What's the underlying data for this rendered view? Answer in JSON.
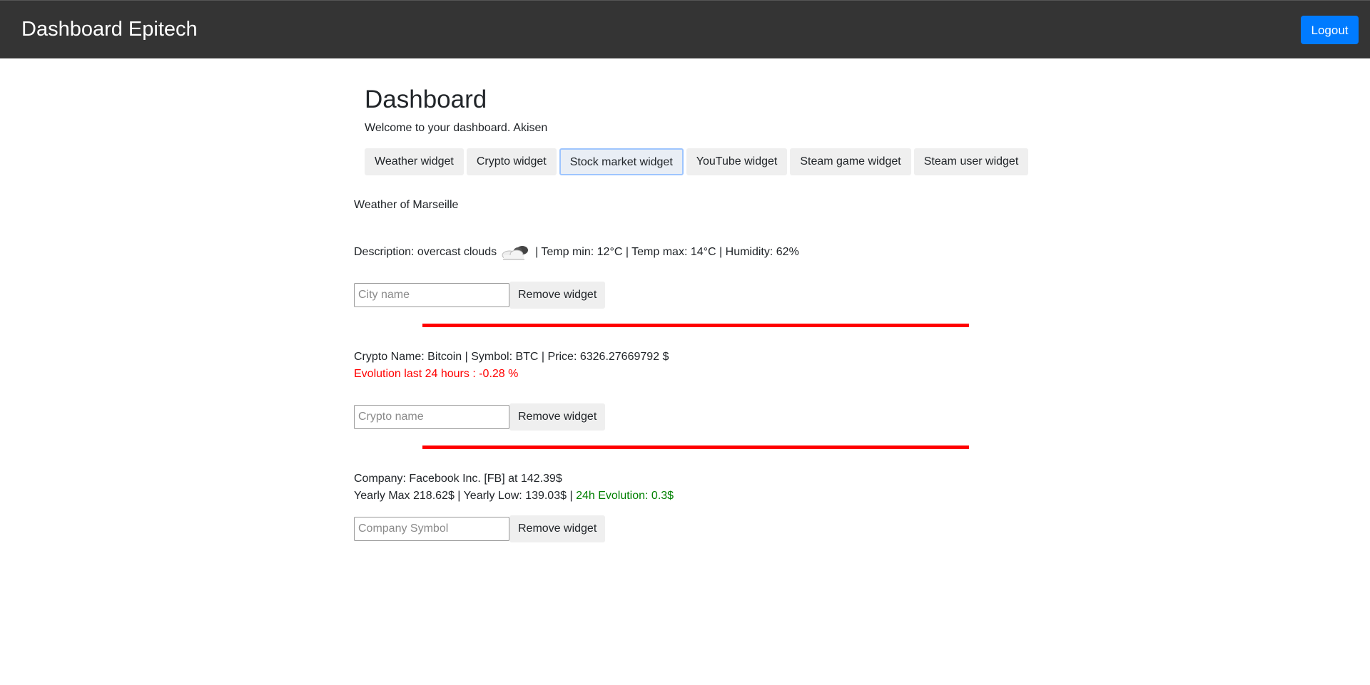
{
  "navbar": {
    "brand": "Dashboard Epitech",
    "logout_label": "Logout",
    "logout_color": "#007bff"
  },
  "header": {
    "title": "Dashboard",
    "welcome": "Welcome to your dashboard.",
    "username": "Akisen"
  },
  "tabs": [
    {
      "label": "Weather widget",
      "active": false
    },
    {
      "label": "Crypto widget",
      "active": false
    },
    {
      "label": "Stock market widget",
      "active": true
    },
    {
      "label": "YouTube widget",
      "active": false
    },
    {
      "label": "Steam game widget",
      "active": false
    },
    {
      "label": "Steam user widget",
      "active": false
    }
  ],
  "weather": {
    "title": "Weather of Marseille",
    "description_prefix": "Description: overcast clouds",
    "icon": "overcast-clouds-icon",
    "stats": "| Temp min: 12°C | Temp max: 14°C | Humidity: 62%",
    "input_placeholder": "City name",
    "remove_label": "Remove widget"
  },
  "crypto": {
    "info": "Crypto Name: Bitcoin | Symbol: BTC | Price: 6326.27669792 $",
    "evolution": "Evolution last 24 hours : -0.28 %",
    "evolution_color": "#ff0000",
    "input_placeholder": "Crypto name",
    "remove_label": "Remove widget"
  },
  "stock": {
    "company": "Company: Facebook Inc. [FB] at 142.39$",
    "yearly": "Yearly Max 218.62$ | Yearly Low: 139.03$ |",
    "evolution": "24h Evolution: 0.3$",
    "evolution_color": "#008000",
    "input_placeholder": "Company Symbol",
    "remove_label": "Remove widget"
  },
  "colors": {
    "separator": "#ff0000",
    "navbar_bg": "#343434"
  }
}
